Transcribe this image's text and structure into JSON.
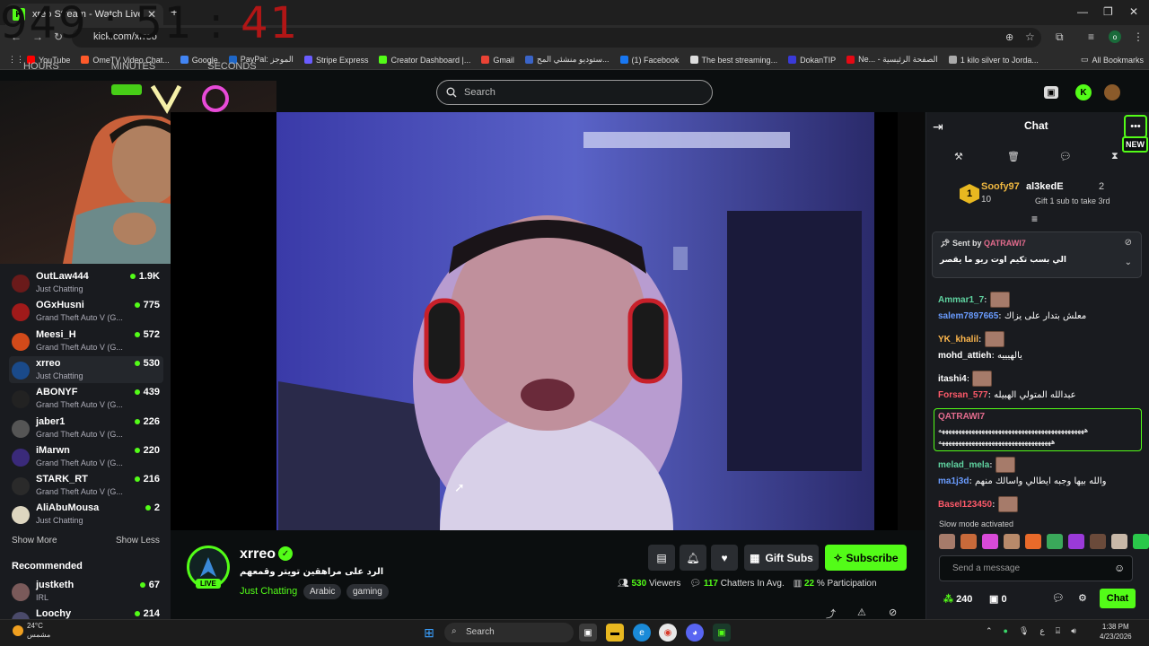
{
  "browser": {
    "tab_title": "xreo Stream - Watch Live",
    "url": "kick.com/xrreo",
    "bookmarks": [
      {
        "label": "YouTube",
        "color": "#ff0000"
      },
      {
        "label": "OmeTV Video Chat...",
        "color": "#ff5a2a"
      },
      {
        "label": "Google",
        "color": "#4285f4"
      },
      {
        "label": "PayPal: الموجز",
        "color": "#1e66c6"
      },
      {
        "label": "Stripe Express",
        "color": "#6a5cff"
      },
      {
        "label": "Creator Dashboard |...",
        "color": "#53fc18"
      },
      {
        "label": "Gmail",
        "color": "#ea4335"
      },
      {
        "label": "ستوديو منشئي المح...",
        "color": "#3a64c8"
      },
      {
        "label": "(1) Facebook",
        "color": "#1877f2"
      },
      {
        "label": "The best streaming...",
        "color": "#dddddd"
      },
      {
        "label": "DokanTIP",
        "color": "#3a3ad8"
      },
      {
        "label": "Ne... - الصفحة الرئيسية",
        "color": "#e50914"
      },
      {
        "label": "1 kilo silver to Jorda...",
        "color": "#aaaaaa"
      }
    ],
    "all_bookmarks": "All Bookmarks"
  },
  "overlay_clock": {
    "hours": "949",
    "minutes": "51",
    "seconds": "41",
    "labels": [
      "HOURS",
      "MINUTES",
      "SECONDS"
    ]
  },
  "search": {
    "placeholder": "Search"
  },
  "sidebar": {
    "channels": [
      {
        "name": "OutLaw444",
        "category": "Just Chatting",
        "viewers": "1.9K",
        "color": "#6a1a1a"
      },
      {
        "name": "OGxHusni",
        "category": "Grand Theft Auto V (G...",
        "viewers": "775",
        "color": "#a01a1a"
      },
      {
        "name": "Meesi_H",
        "category": "Grand Theft Auto V (G...",
        "viewers": "572",
        "color": "#d24a1a"
      },
      {
        "name": "xrreo",
        "category": "Just Chatting",
        "viewers": "530",
        "color": "#1a4a8a"
      },
      {
        "name": "ABONYF",
        "category": "Grand Theft Auto V (G...",
        "viewers": "439",
        "color": "#222222"
      },
      {
        "name": "jaber1",
        "category": "Grand Theft Auto V (G...",
        "viewers": "226",
        "color": "#555555"
      },
      {
        "name": "iMarwn",
        "category": "Grand Theft Auto V (G...",
        "viewers": "220",
        "color": "#3a2a7a"
      },
      {
        "name": "STARK_RT",
        "category": "Grand Theft Auto V (G...",
        "viewers": "216",
        "color": "#2a2a2a"
      },
      {
        "name": "AliAbuMousa",
        "category": "Just Chatting",
        "viewers": "2",
        "color": "#ddd6c0"
      }
    ],
    "show_more": "Show More",
    "show_less": "Show Less",
    "recommended_title": "Recommended",
    "recommended": [
      {
        "name": "justketh",
        "category": "IRL",
        "viewers": "67",
        "color": "#7a5a5a"
      },
      {
        "name": "Loochy",
        "category": "",
        "viewers": "214",
        "color": "#4a4a6a"
      }
    ]
  },
  "stream": {
    "name": "xrreo",
    "live_label": "LIVE",
    "title": "الرد على مراهقين تويتر وقمعهم",
    "category": "Just Chatting",
    "tags": [
      "Arabic",
      "gaming"
    ],
    "gift_subs": "Gift Subs",
    "subscribe": "Subscribe",
    "viewers_value": "530",
    "viewers_label": "Viewers",
    "chatters_value": "117",
    "chatters_label": "Chatters In Avg.",
    "participation_value": "22",
    "participation_label": "% Participation"
  },
  "chat": {
    "title": "Chat",
    "new_label": "NEW",
    "leaderboard": {
      "rank": "1",
      "first_name": "Soofy97",
      "first_count": "10",
      "second_name": "al3kedE",
      "second_count": "2",
      "gift_prompt": "Gift 1 sub to take 3rd"
    },
    "pinned": {
      "sent_by": "Sent by",
      "user": "QATRAWI7",
      "text": "الي بسب تكيم اوت ريو ما يقصر"
    },
    "messages": [
      {
        "user": "Ammar1_7",
        "text": "",
        "color": "#5fd3a0",
        "emote": true
      },
      {
        "user": "salem7897665",
        "text": "معلش بتدار على يزاك",
        "color": "#6a9cff",
        "emote": false
      },
      {
        "user": "YK_khalil",
        "text": "",
        "color": "#ffb84d",
        "emote": true
      },
      {
        "user": "mohd_attieh",
        "text": "يالهيييه",
        "color": "#ffffff",
        "emote": false
      },
      {
        "user": "itashi4",
        "text": "",
        "color": "#ffffff",
        "emote": true
      },
      {
        "user": "Forsan_577",
        "text": "عبدالله المتولي الهبيله",
        "color": "#ff5a6a",
        "emote": false
      }
    ],
    "highlight": {
      "user": "QATRAWI7",
      "line1": "ههههههههههههههههههههههههههههههههههههههههههههه",
      "line2": "ههههههههههههههههههههههههههههههههههه"
    },
    "messages2": [
      {
        "user": "melad_mela",
        "text": "",
        "color": "#5fd3a0",
        "emote": true
      },
      {
        "user": "ma1j3d",
        "text": "والله بيها وجبه ايطالي واسالك منهم",
        "color": "#6a9cff",
        "emote": false
      },
      {
        "user": "Basel123450",
        "text": "",
        "color": "#ff5a6a",
        "emote": true
      }
    ],
    "slow_mode": "Slow mode activated",
    "input_placeholder": "Send a message",
    "points": "240",
    "gifts": "0",
    "chat_button": "Chat"
  },
  "taskbar": {
    "temp": "24°C",
    "weather": "مشمس",
    "search": "Search",
    "time": "1:38 PM",
    "date": "4/23/2026",
    "lang": "ع"
  }
}
